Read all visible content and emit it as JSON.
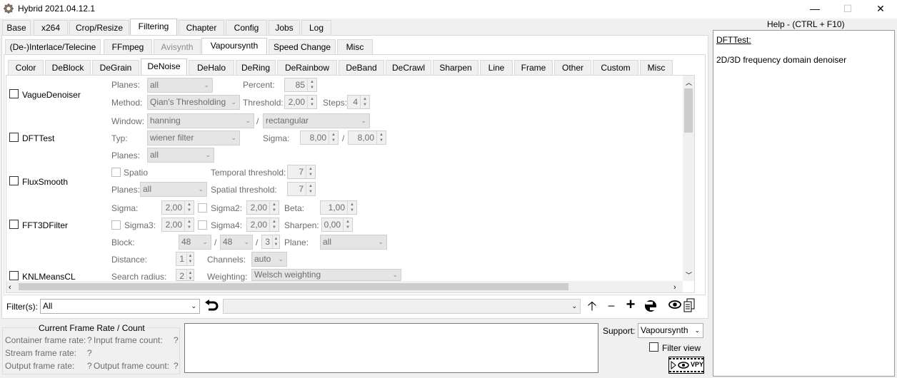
{
  "window": {
    "title": "Hybrid 2021.04.12.1",
    "minimize": "—",
    "maximize": "☐",
    "close": "✕"
  },
  "main_tabs": [
    "Base",
    "x264",
    "Crop/Resize",
    "Filtering",
    "Chapter",
    "Config",
    "Jobs",
    "Log"
  ],
  "filter_tabs": [
    "(De-)Interlace/Telecine",
    "FFmpeg",
    "Avisynth",
    "Vapoursynth",
    "Speed Change",
    "Misc"
  ],
  "vs_tabs": [
    "Color",
    "DeBlock",
    "DeGrain",
    "DeNoise",
    "DeHalo",
    "DeRing",
    "DeRainbow",
    "DeBand",
    "DeCrawl",
    "Sharpen",
    "Line",
    "Frame",
    "Other",
    "Custom",
    "Misc"
  ],
  "vague": {
    "name": "VagueDenoiser",
    "planes_label": "Planes:",
    "planes": "all",
    "percent_label": "Percent:",
    "percent": "85",
    "method_label": "Method:",
    "method": "Qian's Thresholding",
    "threshold_label": "Threshold:",
    "threshold": "2,00",
    "steps_label": "Steps:",
    "steps": "4"
  },
  "dft": {
    "name": "DFTTest",
    "window_label": "Window:",
    "window1": "hanning",
    "sep": "/",
    "window2": "rectangular",
    "typ_label": "Typ:",
    "typ": "wiener filter",
    "sigma_label": "Sigma:",
    "sigma1": "8,00",
    "sigma2": "8,00",
    "planes_label": "Planes:",
    "planes": "all"
  },
  "flux": {
    "name": "FluxSmooth",
    "spatio_label": "Spatio",
    "temporal_label": "Temporal threshold:",
    "temporal": "7",
    "planes_label": "Planes:",
    "planes": "all",
    "spatial_label": "Spatial threshold:",
    "spatial": "7"
  },
  "fft": {
    "name": "FFT3DFilter",
    "sigma_label": "Sigma:",
    "sigma": "2,00",
    "sigma2_label": "Sigma2:",
    "sigma2": "2,00",
    "beta_label": "Beta:",
    "beta": "1,00",
    "sigma3_label": "Sigma3:",
    "sigma3": "2,00",
    "sigma4_label": "Sigma4:",
    "sigma4": "2,00",
    "sharpen_label": "Sharpen:",
    "sharpen": "0,00",
    "block_label": "Block:",
    "block1": "48",
    "block2": "48",
    "block3": "3",
    "plane_label": "Plane:",
    "plane": "all"
  },
  "knl": {
    "name": "KNLMeansCL",
    "distance_label": "Distance:",
    "distance": "1",
    "channels_label": "Channels:",
    "channels": "auto",
    "radius_label": "Search radius:",
    "radius": "2",
    "weighting_label": "Weighting:",
    "weighting": "Welsch weighting"
  },
  "filters_bar": {
    "label": "Filter(s):",
    "value": "All"
  },
  "frame_rate": {
    "title": "Current Frame Rate / Count",
    "container_label": "Container frame rate:",
    "container": "?",
    "input_label": "Input frame count:",
    "input": "?",
    "stream_label": "Stream frame rate:",
    "stream": "?",
    "output_label": "Output frame rate:",
    "output": "?",
    "outcount_label": "Output frame count:",
    "outcount": "?"
  },
  "support": {
    "label": "Support:",
    "value": "Vapoursynth",
    "filter_view": "Filter view",
    "vpy": "VPY"
  },
  "help": {
    "title": "Help - (CTRL + F10)",
    "heading": "DFTTest:",
    "text": "2D/3D frequency domain denoiser"
  }
}
